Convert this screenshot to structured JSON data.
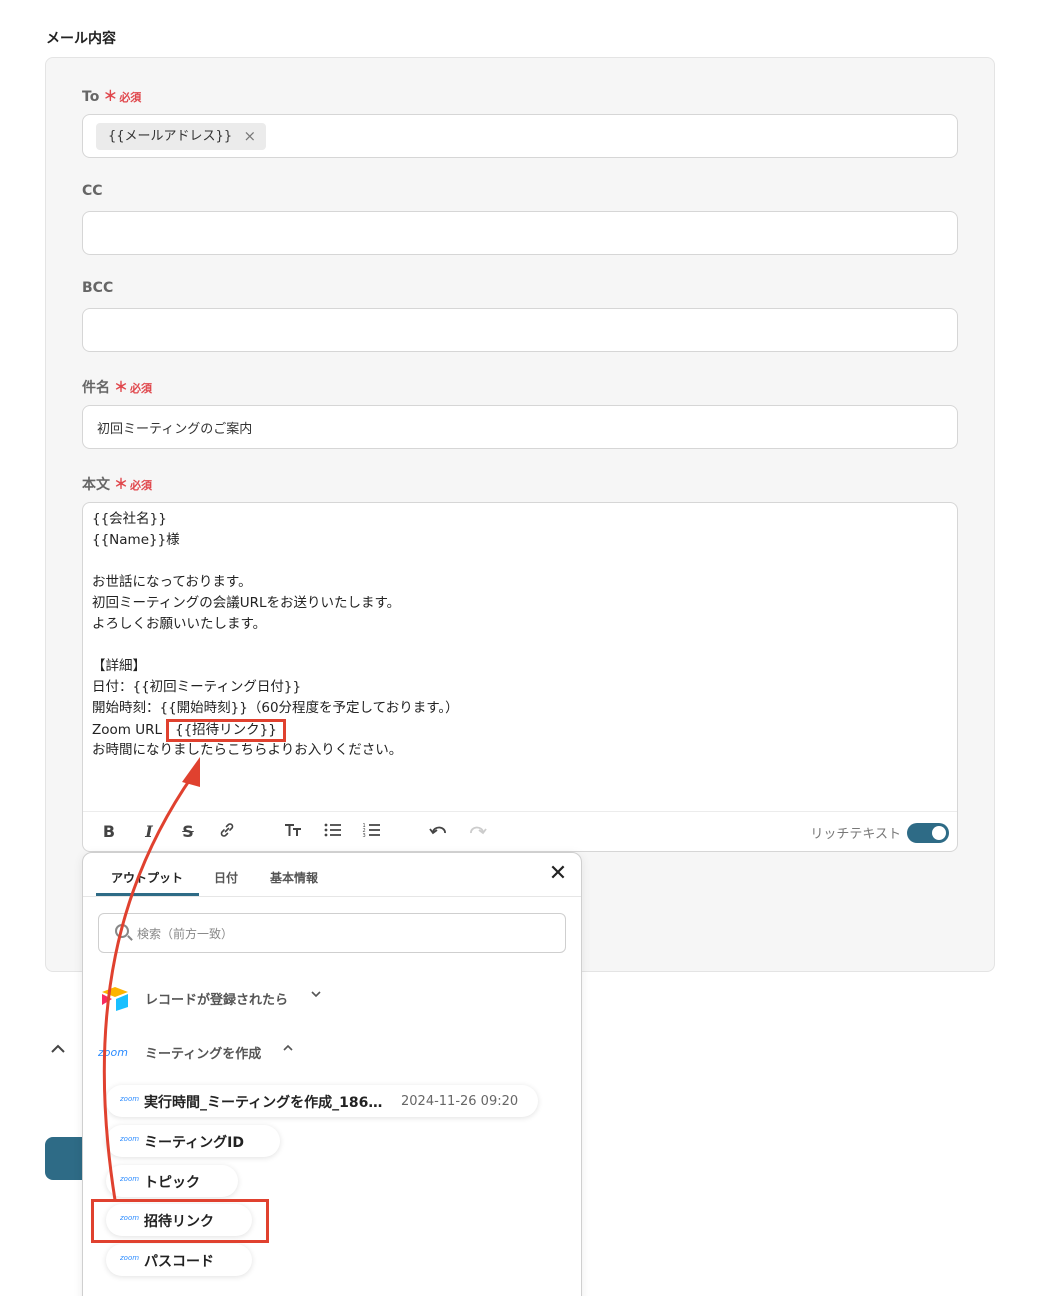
{
  "section_title": "メール内容",
  "required_text": "必須",
  "required_star": "＊",
  "fields": {
    "to": {
      "label": "To",
      "chip": "{{メールアドレス}}",
      "chip_remove": "×"
    },
    "cc": {
      "label": "CC",
      "value": ""
    },
    "bcc": {
      "label": "BCC",
      "value": ""
    },
    "subject": {
      "label": "件名",
      "value": "初回ミーティングのご案内"
    },
    "body": {
      "label": "本文",
      "lines": [
        "{{会社名}}",
        "{{Name}}様",
        "",
        "お世話になっております。",
        "初回ミーティングの会議URLをお送りいたします。",
        "よろしくお願いいたします。",
        "",
        "【詳細】",
        "日付：{{初回ミーティング日付}}",
        "開始時刻：{{開始時刻}}（60分程度を予定しております。）",
        "Zoom URL",
        "お時間になりましたらこちらよりお入りください。"
      ],
      "highlighted_token": "{{招待リンク}}"
    }
  },
  "toolbar": {
    "bold": "B",
    "italic": "I",
    "strike": "S",
    "rich_text_label": "リッチテキスト",
    "rich_text_enabled": true
  },
  "popup": {
    "tabs": [
      "アウトプット",
      "日付",
      "基本情報"
    ],
    "active_tab": "アウトプット",
    "close": "✕",
    "search_placeholder": "検索（前方一致）",
    "groups": [
      {
        "label": "レコードが登録されたら",
        "icon": "airtable-icon",
        "expanded": false
      },
      {
        "label": "ミーティングを作成",
        "icon": "zoom-icon",
        "logo_text": "zoom",
        "expanded": true
      }
    ],
    "items": [
      {
        "label": "実行時間_ミーティングを作成_186…",
        "value": "2024-11-26 09:20"
      },
      {
        "label": "ミーティングID",
        "value": ""
      },
      {
        "label": "トピック",
        "value": ""
      },
      {
        "label": "招待リンク",
        "value": ""
      },
      {
        "label": "パスコード",
        "value": ""
      }
    ],
    "item_logo_text": "zoom"
  },
  "colors": {
    "accent": "#2e6b86",
    "highlight": "#e0412f",
    "required": "#e0474c"
  }
}
